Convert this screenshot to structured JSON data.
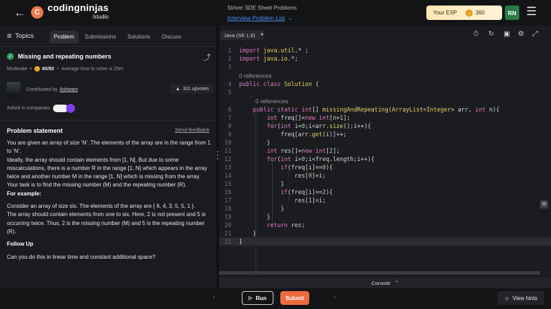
{
  "topbar": {
    "back_icon": "arrow-left-icon",
    "logo_text": "codingninjas",
    "logo_sub": "/studio",
    "crumb_parent": "Striver SDE Sheet Problems",
    "crumb_current": "Interview Problem List",
    "exp_label": "Your EXP",
    "exp_value": "360",
    "avatar_initials": "RN",
    "accent_color": "#ec6b3d"
  },
  "left": {
    "topics_label": "Topics",
    "tabs": [
      {
        "label": "Problem",
        "active": true
      },
      {
        "label": "Submissions",
        "active": false
      },
      {
        "label": "Solutions",
        "active": false
      },
      {
        "label": "Discuss",
        "active": false
      }
    ],
    "problem_title": "Missing and repeating numbers",
    "difficulty": "Moderate",
    "score": "80/80",
    "avg_time": "Average time to solve is 25m",
    "contributed_by_label": "Contributed by",
    "contributor": "Ashwani",
    "upvotes": "311 upvotes",
    "asked_label": "Asked in companies",
    "statement_heading": "Problem statement",
    "send_feedback": "Send feedback",
    "statement": [
      "You are given an array of size ‘N’. The elements of the array are in the range from 1 to ‘N’.",
      "Ideally, the array should contain elements from [1, N]. But due to some miscalculations, there is a number R in the range [1, N] which appears in the array twice and another number M in the range [1, N] which is missing from the array.",
      "Your task is to find the missing number (M) and the repeating number (R)."
    ],
    "example_heading": "For example:",
    "example": [
      "Consider an array of size six. The elements of the array are { 6, 4, 3, 5, 5, 1 }.",
      "The array should contain elements from one to six. Here, 2 is not present and 5 is occurring twice. Thus, 2 is the missing number (M) and 5 is the repeating number (R)."
    ],
    "followup_heading": "Follow Up",
    "followup": "Can you do this in linear time and constant additional space?"
  },
  "editor": {
    "language": "Java (SE 1.8)",
    "references_1": "0 references",
    "references_2": "0 references",
    "console_label": "Console",
    "lines": [
      {
        "n": "1",
        "code": "import java.util.* ;"
      },
      {
        "n": "2",
        "code": "import java.io.*;"
      },
      {
        "n": "3",
        "code": ""
      },
      {
        "n": "4",
        "code": "public class Solution {"
      },
      {
        "n": "5",
        "code": ""
      },
      {
        "n": "6",
        "code": "    public static int[] missingAndRepeating(ArrayList<Integer> arr, int n){"
      },
      {
        "n": "7",
        "code": "        int freq[]=new int[n+1];"
      },
      {
        "n": "8",
        "code": "        for(int i=0;i<arr.size();i++){"
      },
      {
        "n": "9",
        "code": "            freq[arr.get(i)]++;"
      },
      {
        "n": "10",
        "code": "        }"
      },
      {
        "n": "11",
        "code": "        int res[]=new int[2];"
      },
      {
        "n": "12",
        "code": "        for(int i=0;i<freq.length;i++){"
      },
      {
        "n": "13",
        "code": "            if(freq[i]==0){"
      },
      {
        "n": "14",
        "code": "                res[0]=i;"
      },
      {
        "n": "15",
        "code": "            }"
      },
      {
        "n": "16",
        "code": "            if(freq[i]==2){"
      },
      {
        "n": "17",
        "code": "                res[1]=i;"
      },
      {
        "n": "18",
        "code": "            }"
      },
      {
        "n": "19",
        "code": "        }"
      },
      {
        "n": "20",
        "code": "        return res;"
      },
      {
        "n": "21",
        "code": "    }"
      },
      {
        "n": "22",
        "code": "}"
      }
    ]
  },
  "bottom": {
    "run_label": "Run",
    "submit_label": "Submit",
    "hints_label": "View hints"
  }
}
